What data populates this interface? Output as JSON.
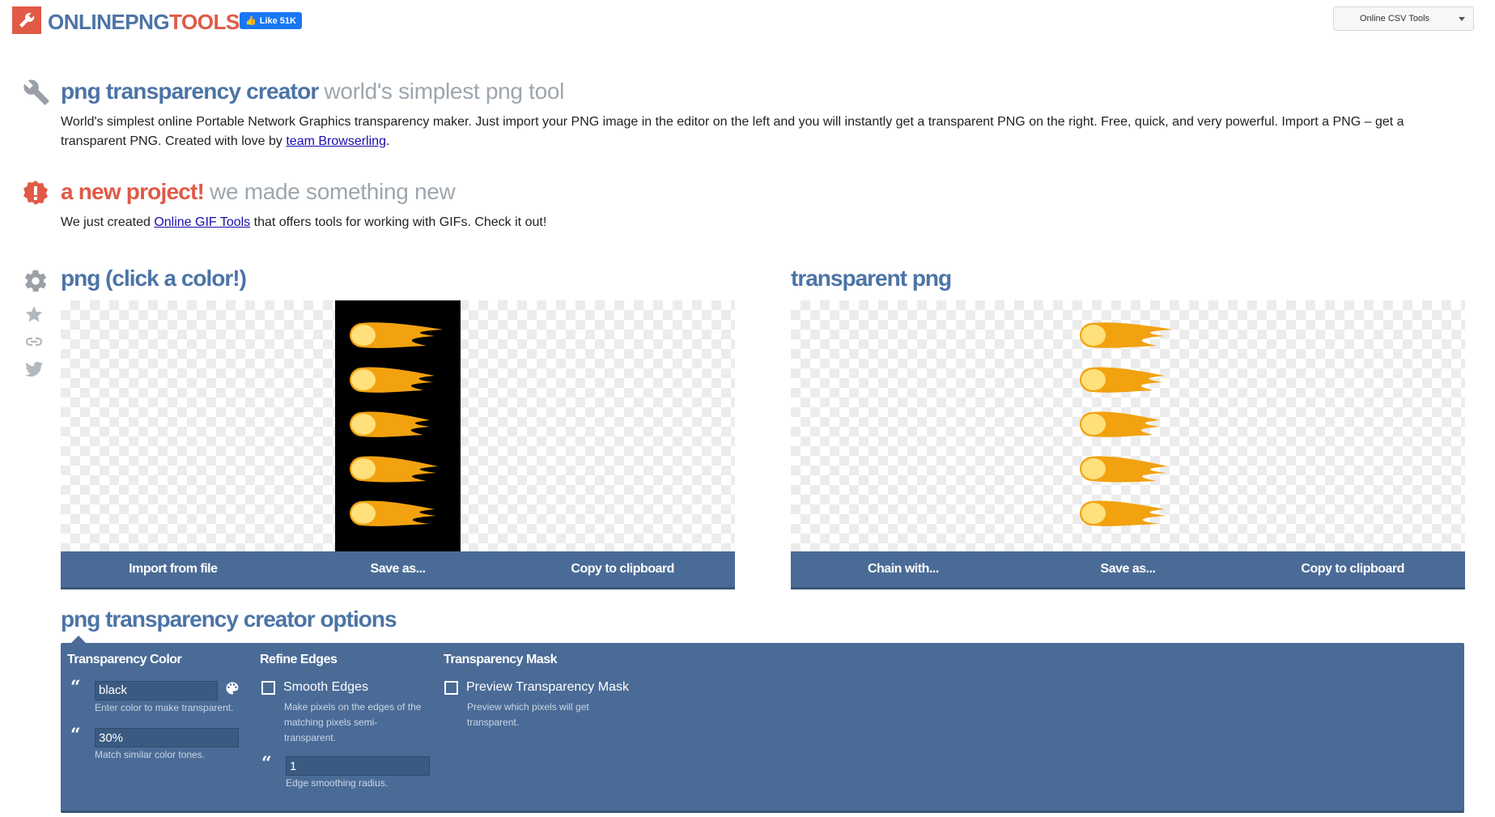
{
  "header": {
    "logo_part1": "ONLINEPNG",
    "logo_part2": "TOOLS",
    "fb_like": "Like 51K",
    "tools_dropdown": "Online CSV Tools"
  },
  "intro": {
    "title": "png transparency creator",
    "subtitle": "world's simplest png tool",
    "desc_before_link": "World's simplest online Portable Network Graphics transparency maker. Just import your PNG image in the editor on the left and you will instantly get a transparent PNG on the right. Free, quick, and very powerful. Import a PNG – get a transparent PNG. Created with love by ",
    "desc_link": "team Browserling",
    "desc_after_link": "."
  },
  "announcement": {
    "title": "a new project!",
    "subtitle": "we made something new",
    "text_before_link": "We just created ",
    "link": "Online GIF Tools",
    "text_after_link": " that offers tools for working with GIFs. Check it out!"
  },
  "input_panel": {
    "title": "png (click a color!)",
    "buttons": [
      "Import from file",
      "Save as...",
      "Copy to clipboard"
    ]
  },
  "output_panel": {
    "title": "transparent png",
    "buttons": [
      "Chain with...",
      "Save as...",
      "Copy to clipboard"
    ]
  },
  "options": {
    "title": "png transparency creator options",
    "transparency_color": {
      "heading": "Transparency Color",
      "color_value": "black",
      "color_help": "Enter color to make transparent.",
      "tolerance_value": "30%",
      "tolerance_help": "Match similar color tones."
    },
    "refine_edges": {
      "heading": "Refine Edges",
      "smooth_label": "Smooth Edges",
      "smooth_help": "Make pixels on the edges of the matching pixels semi-transparent.",
      "radius_value": "1",
      "radius_help": "Edge smoothing radius."
    },
    "transparency_mask": {
      "heading": "Transparency Mask",
      "preview_label": "Preview Transparency Mask",
      "preview_help": "Preview which pixels will get transparent."
    }
  },
  "colors": {
    "brand_blue": "#4c74a6",
    "brand_red": "#e05a47",
    "button_bar": "#4a6b96"
  }
}
